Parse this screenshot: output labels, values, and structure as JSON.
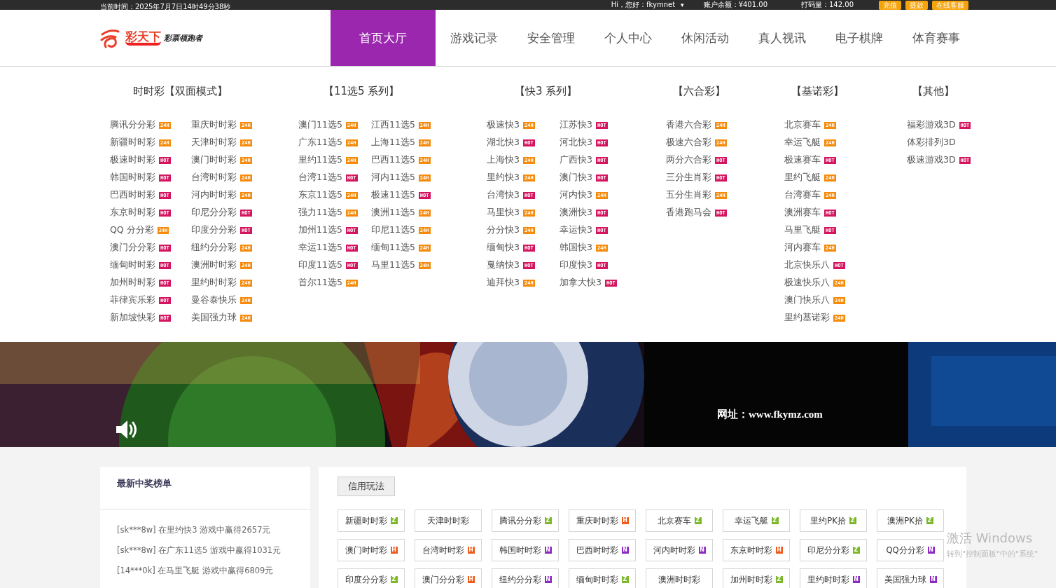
{
  "top_bar": {
    "time": "当前时间：2025年7月7日14时49分38秒",
    "greeting": "Hi，您好：fkymnet",
    "caret": "▾",
    "balance": "账户余额：¥401.00",
    "points": "打码量：142.00",
    "buttons": [
      "充值",
      "提款",
      "在线客服"
    ]
  },
  "logo": {
    "name": "彩天下",
    "slogan": "彩票领跑者"
  },
  "nav": [
    {
      "label": "首页大厅",
      "selected": true
    },
    {
      "label": "游戏记录",
      "selected": false
    },
    {
      "label": "安全管理",
      "selected": false
    },
    {
      "label": "个人中心",
      "selected": false
    },
    {
      "label": "休闲活动",
      "selected": false
    },
    {
      "label": "真人视讯",
      "selected": false
    },
    {
      "label": "电子棋牌",
      "selected": false
    },
    {
      "label": "体育赛事",
      "selected": false
    }
  ],
  "menu": [
    {
      "title": "时时彩【双面模式】",
      "columns": [
        [
          {
            "name": "腾讯分分彩",
            "tag": "24H",
            "kind": "allday"
          },
          {
            "name": "新疆时时彩",
            "tag": "24H",
            "kind": "allday"
          },
          {
            "name": "极速时时彩",
            "tag": "HOT",
            "kind": "hot"
          },
          {
            "name": "韩国时时彩",
            "tag": "HOT",
            "kind": "hot"
          },
          {
            "name": "巴西时时彩",
            "tag": "HOT",
            "kind": "hot"
          },
          {
            "name": "东京时时彩",
            "tag": "HOT",
            "kind": "hot"
          },
          {
            "name": "QQ 分分彩",
            "tag": "24H",
            "kind": "allday"
          },
          {
            "name": "澳门分分彩",
            "tag": "HOT",
            "kind": "hot"
          },
          {
            "name": "缅甸时时彩",
            "tag": "HOT",
            "kind": "hot"
          },
          {
            "name": "加州时时彩",
            "tag": "HOT",
            "kind": "hot"
          },
          {
            "name": "菲律宾乐彩",
            "tag": "HOT",
            "kind": "hot"
          },
          {
            "name": "新加坡快彩",
            "tag": "HOT",
            "kind": "hot"
          }
        ],
        [
          {
            "name": "重庆时时彩",
            "tag": "24H",
            "kind": "allday"
          },
          {
            "name": "天津时时彩",
            "tag": "24H",
            "kind": "allday"
          },
          {
            "name": "澳门时时彩",
            "tag": "24H",
            "kind": "allday"
          },
          {
            "name": "台湾时时彩",
            "tag": "24H",
            "kind": "allday"
          },
          {
            "name": "河内时时彩",
            "tag": "24H",
            "kind": "allday"
          },
          {
            "name": "印尼分分彩",
            "tag": "HOT",
            "kind": "hot"
          },
          {
            "name": "印度分分彩",
            "tag": "HOT",
            "kind": "hot"
          },
          {
            "name": "纽约分分彩",
            "tag": "24H",
            "kind": "allday"
          },
          {
            "name": "澳洲时时彩",
            "tag": "24H",
            "kind": "allday"
          },
          {
            "name": "里约时时彩",
            "tag": "24H",
            "kind": "allday"
          },
          {
            "name": "曼谷泰快乐",
            "tag": "24H",
            "kind": "allday"
          },
          {
            "name": "美国强力球",
            "tag": "24H",
            "kind": "allday"
          }
        ]
      ]
    },
    {
      "title": "【11选5 系列】",
      "columns": [
        [
          {
            "name": "澳门11选5",
            "tag": "24H",
            "kind": "allday"
          },
          {
            "name": "广东11选5",
            "tag": "24H",
            "kind": "allday"
          },
          {
            "name": "里约11选5",
            "tag": "24H",
            "kind": "allday"
          },
          {
            "name": "台湾11选5",
            "tag": "HOT",
            "kind": "hot"
          },
          {
            "name": "东京11选5",
            "tag": "24H",
            "kind": "allday"
          },
          {
            "name": "强力11选5",
            "tag": "24H",
            "kind": "allday"
          },
          {
            "name": "加州11选5",
            "tag": "HOT",
            "kind": "hot"
          },
          {
            "name": "幸运11选5",
            "tag": "HOT",
            "kind": "hot"
          },
          {
            "name": "印度11选5",
            "tag": "HOT",
            "kind": "hot"
          },
          {
            "name": "首尔11选5",
            "tag": "24H",
            "kind": "allday"
          }
        ],
        [
          {
            "name": "江西11选5",
            "tag": "24H",
            "kind": "allday"
          },
          {
            "name": "上海11选5",
            "tag": "24H",
            "kind": "allday"
          },
          {
            "name": "巴西11选5",
            "tag": "24H",
            "kind": "allday"
          },
          {
            "name": "河内11选5",
            "tag": "24H",
            "kind": "allday"
          },
          {
            "name": "极速11选5",
            "tag": "HOT",
            "kind": "hot"
          },
          {
            "name": "澳洲11选5",
            "tag": "24H",
            "kind": "allday"
          },
          {
            "name": "印尼11选5",
            "tag": "24H",
            "kind": "allday"
          },
          {
            "name": "缅甸11选5",
            "tag": "24H",
            "kind": "allday"
          },
          {
            "name": "马里11选5",
            "tag": "24H",
            "kind": "allday"
          }
        ]
      ]
    },
    {
      "title": "【快3 系列】",
      "columns": [
        [
          {
            "name": "极速快3",
            "tag": "24H",
            "kind": "allday"
          },
          {
            "name": "湖北快3",
            "tag": "HOT",
            "kind": "hot"
          },
          {
            "name": "上海快3",
            "tag": "24H",
            "kind": "allday"
          },
          {
            "name": "里约快3",
            "tag": "24H",
            "kind": "allday"
          },
          {
            "name": "台湾快3",
            "tag": "HOT",
            "kind": "hot"
          },
          {
            "name": "马里快3",
            "tag": "24H",
            "kind": "allday"
          },
          {
            "name": "分分快3",
            "tag": "24H",
            "kind": "allday"
          },
          {
            "name": "缅甸快3",
            "tag": "HOT",
            "kind": "hot"
          },
          {
            "name": "戛纳快3",
            "tag": "HOT",
            "kind": "hot"
          },
          {
            "name": "迪拜快3",
            "tag": "24H",
            "kind": "allday"
          }
        ],
        [
          {
            "name": "江苏快3",
            "tag": "HOT",
            "kind": "hot"
          },
          {
            "name": "河北快3",
            "tag": "HOT",
            "kind": "hot"
          },
          {
            "name": "广西快3",
            "tag": "HOT",
            "kind": "hot"
          },
          {
            "name": "澳门快3",
            "tag": "HOT",
            "kind": "hot"
          },
          {
            "name": "河内快3",
            "tag": "24H",
            "kind": "allday"
          },
          {
            "name": "澳洲快3",
            "tag": "HOT",
            "kind": "hot"
          },
          {
            "name": "幸运快3",
            "tag": "HOT",
            "kind": "hot"
          },
          {
            "name": "韩国快3",
            "tag": "24H",
            "kind": "allday"
          },
          {
            "name": "印度快3",
            "tag": "HOT",
            "kind": "hot"
          },
          {
            "name": "加拿大快3",
            "tag": "HOT",
            "kind": "hot"
          }
        ]
      ]
    },
    {
      "title": "【六合彩】",
      "columns": [
        [
          {
            "name": "香港六合彩",
            "tag": "24H",
            "kind": "allday"
          },
          {
            "name": "极速六合彩",
            "tag": "24H",
            "kind": "allday"
          },
          {
            "name": "两分六合彩",
            "tag": "HOT",
            "kind": "hot"
          },
          {
            "name": "三分生肖彩",
            "tag": "HOT",
            "kind": "hot"
          },
          {
            "name": "五分生肖彩",
            "tag": "24H",
            "kind": "allday"
          },
          {
            "name": "香港跑马会",
            "tag": "HOT",
            "kind": "hot"
          }
        ]
      ]
    },
    {
      "title": "【基诺彩】",
      "columns": [
        [
          {
            "name": "北京赛车",
            "tag": "24H",
            "kind": "allday"
          },
          {
            "name": "幸运飞艇",
            "tag": "24H",
            "kind": "allday"
          },
          {
            "name": "极速赛车",
            "tag": "HOT",
            "kind": "hot"
          },
          {
            "name": "里约飞艇",
            "tag": "24H",
            "kind": "allday"
          },
          {
            "name": "台湾赛车",
            "tag": "24H",
            "kind": "allday"
          },
          {
            "name": "澳洲赛车",
            "tag": "HOT",
            "kind": "hot"
          },
          {
            "name": "马里飞艇",
            "tag": "HOT",
            "kind": "hot"
          },
          {
            "name": "河内赛车",
            "tag": "24H",
            "kind": "allday"
          },
          {
            "name": "北京快乐八",
            "tag": "HOT",
            "kind": "hot"
          },
          {
            "name": "极速快乐八",
            "tag": "24H",
            "kind": "allday"
          },
          {
            "name": "澳门快乐八",
            "tag": "24H",
            "kind": "allday"
          },
          {
            "name": "里约基诺彩",
            "tag": "24H",
            "kind": "allday"
          }
        ]
      ]
    },
    {
      "title": "【其他】",
      "columns": [
        [
          {
            "name": "福彩游戏3D",
            "tag": "HOT",
            "kind": "hot"
          },
          {
            "name": "体彩排列3D",
            "kind": "plain"
          },
          {
            "name": "极速游戏3D",
            "tag": "HOT",
            "kind": "hot"
          }
        ]
      ]
    }
  ],
  "banner": {
    "kind": "picture",
    "website": "网址：www.fkymz.com"
  },
  "winners": {
    "title": "最新中奖榜单",
    "entries": [
      "[sk***8w] 在里约快3 游戏中赢得2657元",
      "[sk***8w] 在广东11选5 游戏中赢得1031元",
      "[14***0k] 在马里飞艇 游戏中赢得6809元"
    ]
  },
  "games": {
    "mode_button": "信用玩法",
    "items": [
      {
        "name": "新疆时时彩",
        "badge": "Z",
        "kind": "z"
      },
      {
        "name": "天津时时彩",
        "kind": "plain"
      },
      {
        "name": "腾讯分分彩",
        "badge": "Z",
        "kind": "z"
      },
      {
        "name": "重庆时时彩",
        "badge": "H",
        "kind": "h"
      },
      {
        "name": "北京赛车",
        "badge": "Z",
        "kind": "z"
      },
      {
        "name": "幸运飞艇",
        "badge": "Z",
        "kind": "z"
      },
      {
        "name": "里约PK拾",
        "badge": "Z",
        "kind": "z"
      },
      {
        "name": "澳洲PK拾",
        "badge": "Z",
        "kind": "z"
      },
      {
        "name": "澳门时时彩",
        "badge": "H",
        "kind": "h"
      },
      {
        "name": "台湾时时彩",
        "badge": "H",
        "kind": "h"
      },
      {
        "name": "韩国时时彩",
        "badge": "N",
        "kind": "n"
      },
      {
        "name": "巴西时时彩",
        "badge": "N",
        "kind": "n"
      },
      {
        "name": "河内时时彩",
        "badge": "N",
        "kind": "n"
      },
      {
        "name": "东京时时彩",
        "badge": "H",
        "kind": "h"
      },
      {
        "name": "印尼分分彩",
        "badge": "Z",
        "kind": "z"
      },
      {
        "name": "QQ分分彩",
        "badge": "N",
        "kind": "n"
      },
      {
        "name": "印度分分彩",
        "badge": "Z",
        "kind": "z"
      },
      {
        "name": "澳门分分彩",
        "badge": "H",
        "kind": "h"
      },
      {
        "name": "纽约分分彩",
        "badge": "N",
        "kind": "n"
      },
      {
        "name": "缅甸时时彩",
        "badge": "Z",
        "kind": "z"
      },
      {
        "name": "澳洲时时彩",
        "kind": "plain"
      },
      {
        "name": "加州时时彩",
        "badge": "Z",
        "kind": "z"
      },
      {
        "name": "里约时时彩",
        "badge": "N",
        "kind": "n"
      },
      {
        "name": "美国强力球",
        "badge": "N",
        "kind": "n"
      }
    ]
  },
  "windows_notice": {
    "title": "激活 Windows",
    "hint": "转到\"控制面板\"中的\"系统\""
  }
}
